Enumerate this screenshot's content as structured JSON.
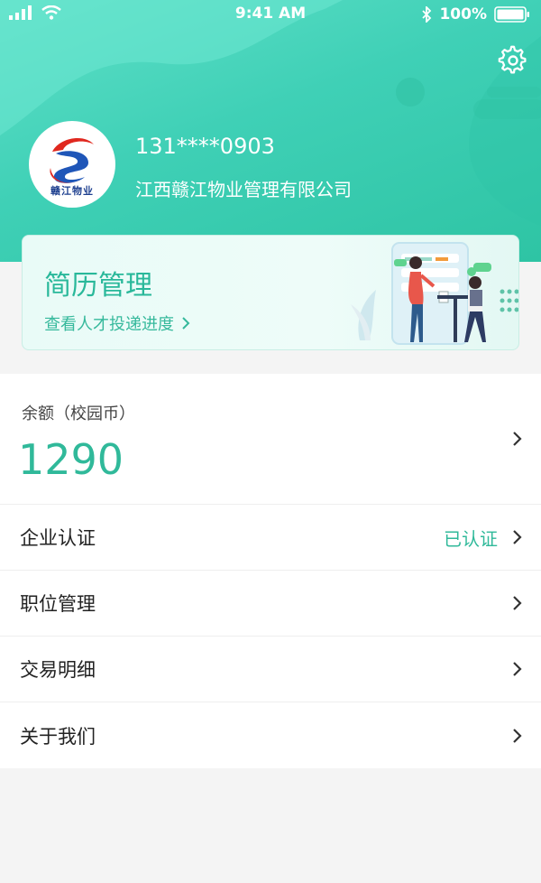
{
  "status_bar": {
    "time": "9:41 AM",
    "battery": "100%"
  },
  "profile": {
    "phone": "131****0903",
    "company": "江西赣江物业管理有限公司",
    "avatar_caption": "赣江物业"
  },
  "resume_card": {
    "title": "简历管理",
    "subtitle": "查看人才投递进度"
  },
  "balance": {
    "label": "余额（校园币）",
    "value": "1290"
  },
  "menu": [
    {
      "label": "企业认证",
      "status": "已认证"
    },
    {
      "label": "职位管理"
    },
    {
      "label": "交易明细"
    },
    {
      "label": "关于我们"
    }
  ],
  "colors": {
    "accent": "#30b99a",
    "header": "#3fd0b6"
  }
}
